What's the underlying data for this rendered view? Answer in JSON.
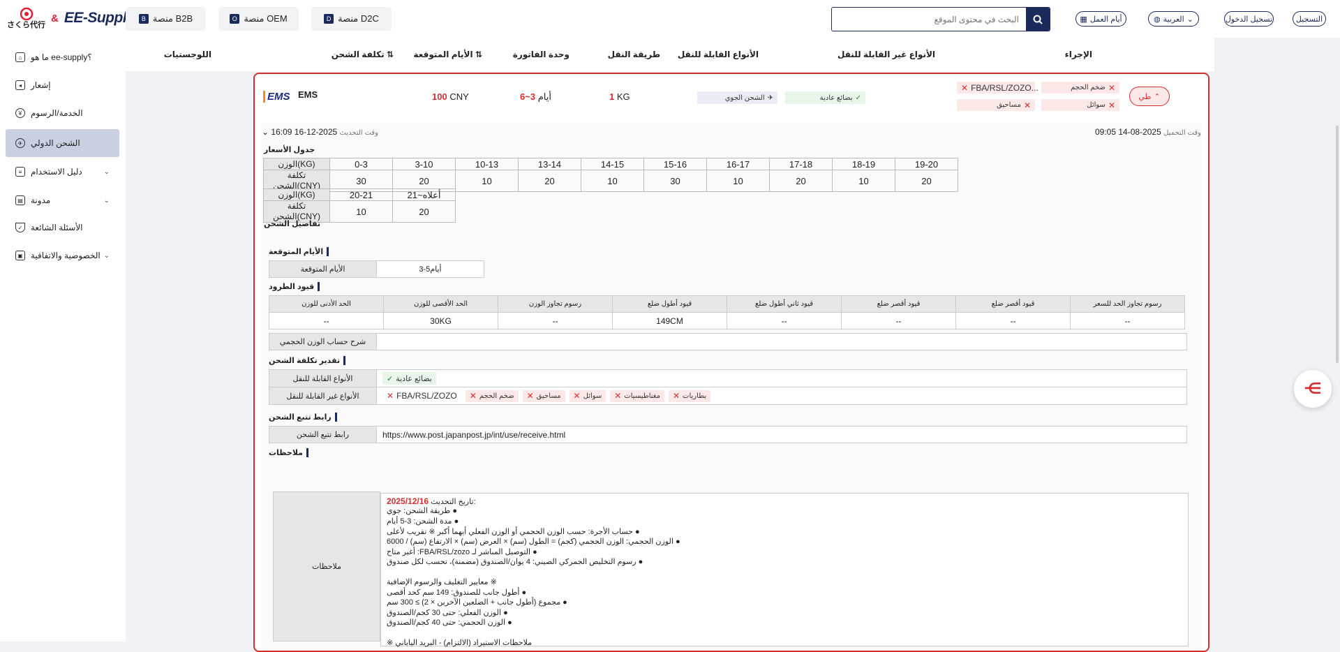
{
  "brand": {
    "sakura_logo_text": "さくら代行",
    "amp": "&",
    "ee_logo_text": "EE-Supply"
  },
  "platforms": [
    {
      "label": "منصة B2B",
      "icon": "b2b-icon"
    },
    {
      "label": "منصة OEM",
      "icon": "oem-icon"
    },
    {
      "label": "منصة D2C",
      "icon": "d2c-icon"
    }
  ],
  "search": {
    "placeholder": "البحث في محتوى الموقع"
  },
  "top_right": {
    "workdays": "أيام العمل",
    "language": "العربية",
    "login": "تسجيل الدخول",
    "register": "التسجيل"
  },
  "sidebar": {
    "items": [
      {
        "label": "ما هو ee-supply؟",
        "icon": "home-icon"
      },
      {
        "label": "إشعار",
        "icon": "megaphone-icon"
      },
      {
        "label": "الخدمة/الرسوم",
        "icon": "coin-icon"
      },
      {
        "label": "الشحن الدولي",
        "icon": "shipping-icon",
        "active": true
      },
      {
        "label": "دليل الاستخدام",
        "icon": "book-icon"
      },
      {
        "label": "مدونة",
        "icon": "blog-icon"
      },
      {
        "label": "الأسئلة الشائعة",
        "icon": "faq-icon"
      },
      {
        "label": "الخصوصية والاتفاقية",
        "icon": "privacy-icon"
      }
    ]
  },
  "table_header": {
    "action": "الإجراء",
    "non_transportable": "الأنواع غير القابلة للنقل",
    "transportable": "الأنواع القابلة للنقل",
    "transport_method": "طريقة النقل",
    "invoice_unit": "وحدة الفاتورة",
    "expected_days": "الأيام المتوقعة",
    "shipping_cost": "تكلفة الشحن",
    "logistics": "اللوجستيات"
  },
  "row": {
    "carrier": "EMS",
    "carrier_logo_text": "EMS",
    "cost_value": "100",
    "cost_currency": "CNY",
    "days_value": "3~6",
    "days_unit": "أيام",
    "unit_value": "1",
    "unit_label": "KG",
    "method": "الشحن الجوي",
    "transportable_tag": "بضائع عادية",
    "non_transportable": [
      "ضخم الحجم",
      "FBA/RSL/ZOZO...",
      "سوائل",
      "مساحيق"
    ],
    "collapse_label": "طي"
  },
  "detail": {
    "upload_time_label": "وقت التحميل",
    "upload_time": "2025-08-14 09:05",
    "update_time_label": "وقت التحديث",
    "update_time": "2025-12-16 16:09",
    "price_table_title": "جدول الأسعار",
    "weight_label": "الوزن(KG)",
    "cost_label": "تكلفة الشحن(CNY)",
    "price_ranges_1": [
      "0-3",
      "3-10",
      "10-13",
      "13-14",
      "14-15",
      "15-16",
      "16-17",
      "17-18",
      "18-19",
      "19-20"
    ],
    "price_values_1": [
      "30",
      "20",
      "10",
      "20",
      "10",
      "30",
      "10",
      "20",
      "10",
      "20"
    ],
    "price_ranges_2": [
      "20-21",
      "21~أعلاه"
    ],
    "price_values_2": [
      "10",
      "20"
    ],
    "shipping_details_title": "تفاصيل الشحن",
    "expected_days_title": "الأيام المتوقعة",
    "expected_days_label": "الأيام المتوقعة",
    "expected_days_value": "3-5أيام",
    "parcel_limits_title": "قيود الطرود",
    "parcel_columns": [
      "رسوم تجاوز الحد للسعر",
      "قيود أقصر ضلع",
      "قيود أقصر ضلع",
      "قيود ثاني أطول ضلع",
      "قيود أطول ضلع",
      "رسوم تجاوز الوزن",
      "الحد الأقصى للوزن",
      "الحد الأدنى للوزن"
    ],
    "parcel_values": [
      "--",
      "--",
      "--",
      "--",
      "149CM",
      "--",
      "30KG",
      "--"
    ],
    "volumetric_label": "شرح حساب الوزن الحجمي",
    "cost_estimate_title": "تقدير تكلفة الشحن",
    "transportable_label": "الأنواع القابلة للنقل",
    "transportable_value": "بضائع عادية",
    "non_transportable_label": "الأنواع غير القابلة للنقل",
    "non_transportable_values": [
      "FBA/RSL/ZOZO",
      "ضخم الحجم",
      "مساحيق",
      "سوائل",
      "مغناطيسيات",
      "بطاريات"
    ],
    "tracking_title": "رابط تتبع الشحن",
    "tracking_label": "رابط تتبع الشحن",
    "tracking_url": "https://www.post.japanpost.jp/int/use/receive.html",
    "notes_title": "ملاحظات",
    "notes_label": "ملاحظات",
    "notes_date_label": "تاريخ التحديث:",
    "notes_date": "2025/12/16",
    "notes_lines": [
      "طريقة الشحن: جوي ●",
      "مدة الشحن: 3-5 أيام ●",
      "حساب الأجرة: حسب الوزن الحجمي أو الوزن الفعلي أيهما أكبر ※ تقريب لأعلى ●",
      "الوزن الحجمي: الوزن الحجمي (كجم) = الطول (سم) × العرض (سم) × الارتفاع (سم) / 6000 ●",
      "أغير متاح :FBA/RSL/zozo التوصيل المباشر لـ ●",
      "رسوم التخليص الجمركي الصيني: 4 يوان/الصندوق (مضمنة)، تحسب لكل صندوق ●",
      "",
      "معايير التغليف والرسوم الإضافية ※",
      "أطول جانب للصندوق: 149 سم كحد أقصى ●",
      "مجموع (أطول جانب + الضلعين الآخرين × 2) ≥ 300 سم ●",
      "الوزن الفعلي: حتى 30 كجم/الصندوق ●",
      "الوزن الحجمي: حتى 40 كجم/الصندوق ●",
      "",
      "※ ملاحظات الاستيراد (الالتزام) - البريد الياباني"
    ]
  }
}
